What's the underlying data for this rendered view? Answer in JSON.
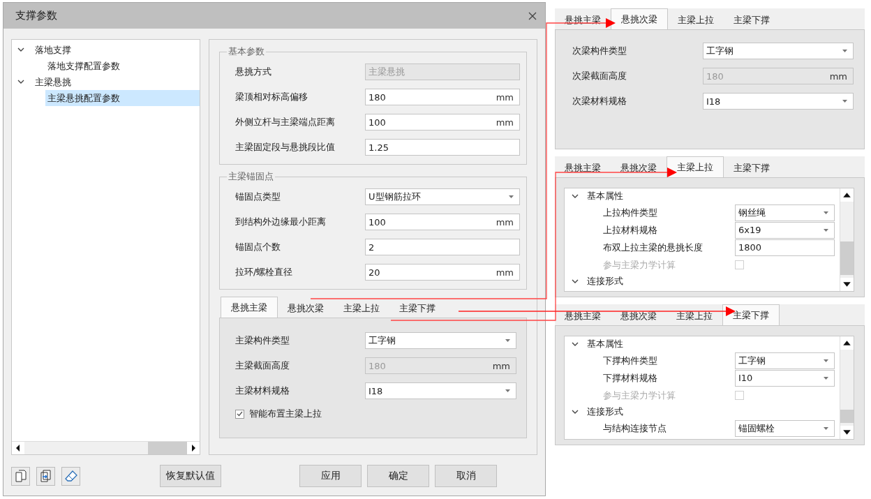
{
  "dialog": {
    "title": "支撑参数"
  },
  "tree": [
    {
      "label": "落地支撑",
      "expanded": true,
      "selected": false,
      "children": [
        {
          "label": "落地支撑配置参数",
          "selected": false
        }
      ]
    },
    {
      "label": "主梁悬挑",
      "expanded": true,
      "selected": false,
      "children": [
        {
          "label": "主梁悬挑配置参数",
          "selected": true
        }
      ]
    }
  ],
  "groups": [
    {
      "title": "基本参数",
      "fields": [
        {
          "label": "悬挑方式",
          "kind": "text",
          "value": "主梁悬挑",
          "disabled": true
        },
        {
          "label": "梁顶相对标高偏移",
          "kind": "text",
          "value": "180",
          "unit": "mm",
          "disabled": false
        },
        {
          "label": "外侧立杆与主梁端点距离",
          "kind": "text",
          "value": "100",
          "unit": "mm",
          "disabled": false
        },
        {
          "label": "主梁固定段与悬挑段比值",
          "kind": "text",
          "value": "1.25",
          "disabled": false
        }
      ]
    },
    {
      "title": "主梁锚固点",
      "fields": [
        {
          "label": "锚固点类型",
          "kind": "select",
          "value": "U型钢筋拉环",
          "disabled": false
        },
        {
          "label": "到结构外边缘最小距离",
          "kind": "text",
          "value": "100",
          "unit": "mm",
          "disabled": false
        },
        {
          "label": "锚固点个数",
          "kind": "text",
          "value": "2",
          "disabled": false
        },
        {
          "label": "拉环/螺栓直径",
          "kind": "text",
          "value": "20",
          "unit": "mm",
          "disabled": false
        }
      ]
    }
  ],
  "main_tabs": {
    "items": [
      {
        "label": "悬挑主梁",
        "selected": true
      },
      {
        "label": "悬挑次梁",
        "selected": false
      },
      {
        "label": "主梁上拉",
        "selected": false
      },
      {
        "label": "主梁下撑",
        "selected": false
      }
    ],
    "fields": [
      {
        "label": "主梁构件类型",
        "kind": "select",
        "value": "工字钢",
        "disabled": false
      },
      {
        "label": "主梁截面高度",
        "kind": "text",
        "value": "180",
        "unit": "mm",
        "disabled": true
      },
      {
        "label": "主梁材料规格",
        "kind": "select",
        "value": "I18",
        "disabled": false
      }
    ],
    "checkbox": {
      "label": "智能布置主梁上拉",
      "checked": true
    }
  },
  "buttons": [
    {
      "label": "恢复默认值"
    },
    {
      "label": "应用"
    },
    {
      "label": "确定"
    },
    {
      "label": "取消"
    }
  ],
  "callouts": [
    {
      "kind": "form",
      "tabs": [
        {
          "label": "悬挑主梁",
          "selected": false
        },
        {
          "label": "悬挑次梁",
          "selected": true
        },
        {
          "label": "主梁上拉",
          "selected": false
        },
        {
          "label": "主梁下撑",
          "selected": false
        }
      ],
      "fields": [
        {
          "label": "次梁构件类型",
          "kind": "select",
          "value": "工字钢",
          "disabled": false
        },
        {
          "label": "次梁截面高度",
          "kind": "text",
          "value": "180",
          "unit": "mm",
          "disabled": true
        },
        {
          "label": "次梁材料规格",
          "kind": "select",
          "value": "I18",
          "disabled": false
        }
      ]
    },
    {
      "kind": "grid",
      "tabs": [
        {
          "label": "悬挑主梁",
          "selected": false
        },
        {
          "label": "悬挑次梁",
          "selected": false
        },
        {
          "label": "主梁上拉",
          "selected": true
        },
        {
          "label": "主梁下撑",
          "selected": false
        }
      ],
      "sections": [
        {
          "title": "基本属性",
          "expanded": true,
          "rows": [
            {
              "label": "上拉构件类型",
              "kind": "select",
              "value": "钢丝绳",
              "disabled": false
            },
            {
              "label": "上拉材料规格",
              "kind": "select",
              "value": "6x19",
              "disabled": false
            },
            {
              "label": "布双上拉主梁的悬挑长度",
              "kind": "text",
              "value": "1800",
              "disabled": false
            },
            {
              "label": "参与主梁力学计算",
              "kind": "checkbox",
              "checked": false,
              "disabled": true
            }
          ]
        },
        {
          "title": "连接形式",
          "expanded": true
        }
      ]
    },
    {
      "kind": "grid",
      "tabs": [
        {
          "label": "悬挑主梁",
          "selected": false
        },
        {
          "label": "悬挑次梁",
          "selected": false
        },
        {
          "label": "主梁上拉",
          "selected": false
        },
        {
          "label": "主梁下撑",
          "selected": true
        }
      ],
      "sections": [
        {
          "title": "基本属性",
          "expanded": true,
          "rows": [
            {
              "label": "下撑构件类型",
              "kind": "select",
              "value": "工字钢",
              "disabled": false
            },
            {
              "label": "下撑材料规格",
              "kind": "select",
              "value": "I10",
              "disabled": false
            },
            {
              "label": "参与主梁力学计算",
              "kind": "checkbox",
              "checked": false,
              "disabled": true
            }
          ]
        },
        {
          "title": "连接形式",
          "expanded": true,
          "rows": [
            {
              "label": "与结构连接节点",
              "kind": "select",
              "value": "锚固螺栓",
              "disabled": false
            }
          ]
        }
      ]
    }
  ]
}
